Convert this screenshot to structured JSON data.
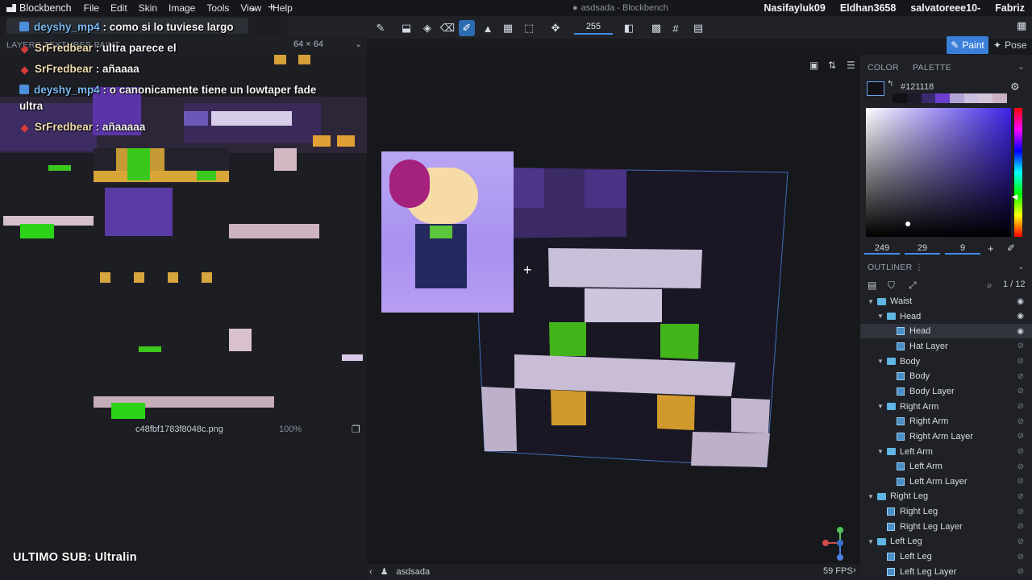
{
  "menubar": {
    "app_name": "Blockbench",
    "items": [
      "File",
      "Edit",
      "Skin",
      "Image",
      "Tools",
      "View",
      "Help"
    ],
    "window_title": "asdsada - Blockbench",
    "users": [
      "Nasifayluk09",
      "Eldhan3658",
      "salvatoreee10-",
      "Fabriz"
    ]
  },
  "tabs": {
    "file_tab": "deyshy_mp4",
    "close": "•",
    "add": "+"
  },
  "toolbar": {
    "brush_size": "255",
    "modes": {
      "paint": "Paint",
      "pose": "Pose"
    }
  },
  "left_panel": {
    "tabs_label": "LAYERS  TEXTURES  PAINT",
    "texture_size": "64 × 64",
    "file_name": "c48fbf1783f8048c.png",
    "zoom": "100%"
  },
  "chat": [
    {
      "user": "deyshy_mp4",
      "badge": "blue",
      "text": " : como si lo tuviese largo"
    },
    {
      "user": "SrFredbear",
      "badge": "red",
      "text": " : ultra parece el"
    },
    {
      "user": "SrFredbear",
      "badge": "red",
      "text": " : añaaaa"
    },
    {
      "user": "deyshy_mp4",
      "badge": "blue",
      "text": " : o canonicamente tiene un lowtaper fade ultra"
    },
    {
      "user": "SrFredbear",
      "badge": "red",
      "text": " : añaaaaa"
    }
  ],
  "sub_banner": "ULTIMO SUB: Ultralin",
  "viewport": {
    "status_name": "asdsada",
    "fps": "59 FPS"
  },
  "color_panel": {
    "tab_color": "COLOR",
    "tab_palette": "PALETTE",
    "hex": "#121118",
    "r": "249",
    "g": "29",
    "b": "9"
  },
  "outliner": {
    "title": "OUTLINER",
    "count": "1 / 12",
    "rows": [
      {
        "label": "Waist",
        "kind": "folder",
        "depth": 0,
        "expanded": true,
        "visible": true
      },
      {
        "label": "Head",
        "kind": "folder",
        "depth": 1,
        "expanded": true,
        "visible": true
      },
      {
        "label": "Head",
        "kind": "cube",
        "depth": 2,
        "selected": true,
        "visible": true
      },
      {
        "label": "Hat Layer",
        "kind": "cube",
        "depth": 2,
        "visible": false
      },
      {
        "label": "Body",
        "kind": "folder",
        "depth": 1,
        "expanded": true,
        "visible": false
      },
      {
        "label": "Body",
        "kind": "cube",
        "depth": 2,
        "visible": false
      },
      {
        "label": "Body Layer",
        "kind": "cube",
        "depth": 2,
        "visible": false
      },
      {
        "label": "Right Arm",
        "kind": "folder",
        "depth": 1,
        "expanded": true,
        "visible": false
      },
      {
        "label": "Right Arm",
        "kind": "cube",
        "depth": 2,
        "visible": false
      },
      {
        "label": "Right Arm Layer",
        "kind": "cube",
        "depth": 2,
        "visible": false
      },
      {
        "label": "Left Arm",
        "kind": "folder",
        "depth": 1,
        "expanded": true,
        "visible": false
      },
      {
        "label": "Left Arm",
        "kind": "cube",
        "depth": 2,
        "visible": false
      },
      {
        "label": "Left Arm Layer",
        "kind": "cube",
        "depth": 2,
        "visible": false
      },
      {
        "label": "Right Leg",
        "kind": "folder",
        "depth": 0,
        "expanded": true,
        "visible": false
      },
      {
        "label": "Right Leg",
        "kind": "cube",
        "depth": 1,
        "visible": false
      },
      {
        "label": "Right Leg Layer",
        "kind": "cube",
        "depth": 1,
        "visible": false
      },
      {
        "label": "Left Leg",
        "kind": "folder",
        "depth": 0,
        "expanded": true,
        "visible": false
      },
      {
        "label": "Left Leg",
        "kind": "cube",
        "depth": 1,
        "visible": false
      },
      {
        "label": "Left Leg Layer",
        "kind": "cube",
        "depth": 1,
        "visible": false
      }
    ]
  },
  "colors": {
    "accent": "#3a80d9",
    "panel": "#1f2126",
    "selected_color": "#121118"
  }
}
